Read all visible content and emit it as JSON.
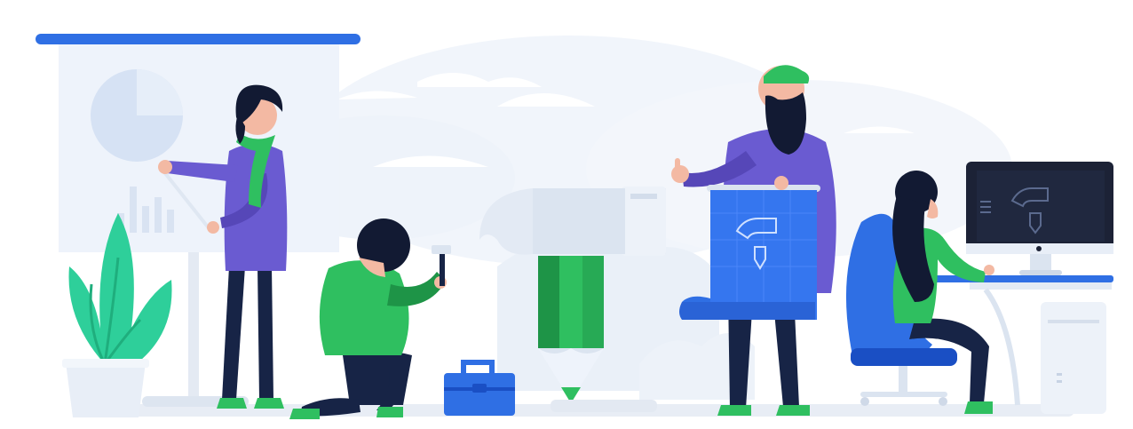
{
  "illustration": {
    "palette": {
      "blue": "#2f6fe4",
      "blue_dark": "#1a4fc4",
      "navy": "#172446",
      "purple": "#6a5bd1",
      "purple_dark": "#5647b8",
      "green": "#2fbf60",
      "green_dark": "#1e9447",
      "teal_plant": "#2ecf9a",
      "skin": "#f3b9a3",
      "hair": "#121a33",
      "board": "#eef3fb",
      "cloud": "#e7eef8",
      "ground": "#e3e9f2",
      "metal": "#dbe4f0",
      "screen": "#1c2236",
      "blueprint": "#3576ef"
    },
    "scene": [
      "presentation-board",
      "pie-chart",
      "bar-chart",
      "potted-plant",
      "woman-presenter",
      "kneeling-man-with-hammer",
      "toolbox",
      "giant-hammer",
      "giant-pencil",
      "bearded-man-with-blueprint",
      "woman-at-desk",
      "office-chair",
      "desktop-monitor",
      "pc-tower"
    ]
  }
}
